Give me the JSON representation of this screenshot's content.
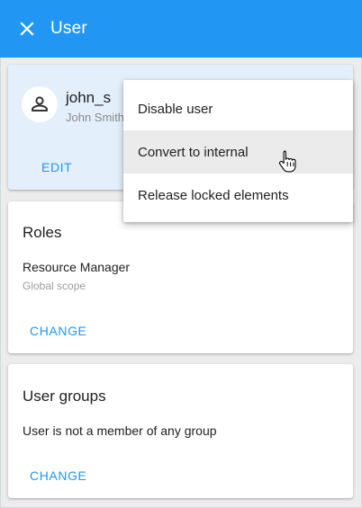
{
  "header": {
    "title": "User",
    "close_icon": "close-icon",
    "background": "#2196f3"
  },
  "user_card": {
    "username": "john_s",
    "full_name": "John Smith",
    "avatar_icon": "person-icon",
    "edit_label": "EDIT"
  },
  "roles_card": {
    "title": "Roles",
    "role_name": "Resource Manager",
    "role_scope": "Global scope",
    "change_label": "CHANGE"
  },
  "groups_card": {
    "title": "User groups",
    "text": "User is not a member of any group",
    "change_label": "CHANGE"
  },
  "context_menu": {
    "items": [
      {
        "label": "Disable user"
      },
      {
        "label": "Convert to internal",
        "hovered": true
      },
      {
        "label": "Release locked elements"
      }
    ]
  },
  "accent_color": "#2196f3"
}
